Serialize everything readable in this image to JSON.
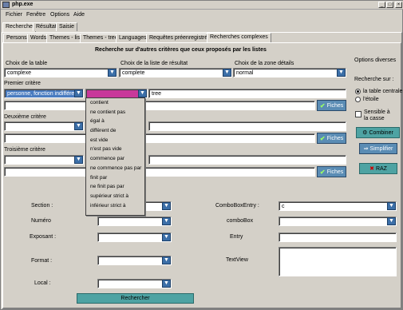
{
  "window": {
    "title": "php.exe"
  },
  "menu": [
    "Fichier",
    "Fenêtre",
    "Options",
    "Aide"
  ],
  "main_tabs": [
    "Recherche",
    "Résultat",
    "Saisie"
  ],
  "sub_tabs": [
    "Persons",
    "Words",
    "Themes - list",
    "Themes - tree",
    "Languages",
    "Requêtes préenregistrées",
    "Recherches complexes"
  ],
  "search": {
    "heading": "Recherche sur d'autres critères que ceux proposés par les listes",
    "table_label": "Choix de la table",
    "table_value": "complexe",
    "result_label": "Choix de la liste de résultat",
    "result_value": "complete",
    "detail_label": "Choix de la zone détails",
    "detail_value": "normal",
    "crit1_label": "Premier critère",
    "crit1_field": "personne, fonction indifférente",
    "crit1_value": "tree",
    "crit2_label": "Deuxième critère",
    "crit3_label": "Troisième critère",
    "fiches_label": "Fiches"
  },
  "options": {
    "title": "Options diverses",
    "search_on": "Recherche sur :",
    "radio1": "la table centrale",
    "radio2": "l'étoile",
    "case_label": "Sensible à la casse",
    "combine": "Combiner",
    "simplify": "Simplifier",
    "raz": "RAZ"
  },
  "dropdown": [
    "contient",
    "ne contient pas",
    "égal à",
    "différent de",
    "est vide",
    "n'est pas vide",
    "commence par",
    "ne commence pas par",
    "finit par",
    "ne finit pas par",
    "supérieur strict à",
    "inférieur strict à"
  ],
  "form": {
    "section": "Section :",
    "numero": "Numéro",
    "exposant": "Exposant :",
    "format": "Format :",
    "local": "Local :",
    "comboboxentry": "ComboBoxEntry :",
    "comboboxentry_value": "c",
    "combobox": "comboBox",
    "entry": "Entry",
    "textview": "TextView",
    "search_btn": "Rechercher"
  }
}
